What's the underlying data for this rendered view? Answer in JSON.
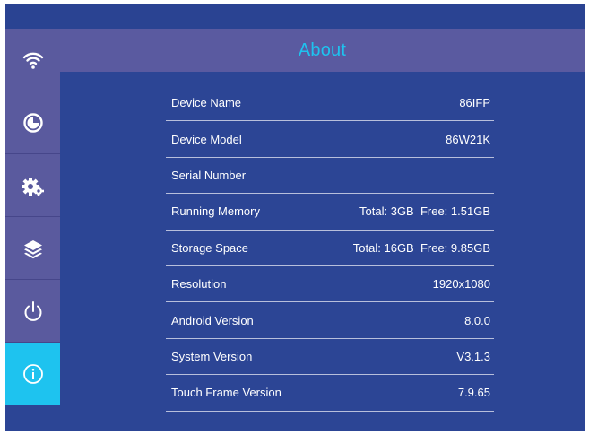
{
  "header": {
    "title": "About"
  },
  "sidebar": {
    "items": [
      {
        "icon": "wifi-icon",
        "active": false
      },
      {
        "icon": "pie-chart-icon",
        "active": false
      },
      {
        "icon": "gears-icon",
        "active": false
      },
      {
        "icon": "layers-icon",
        "active": false
      },
      {
        "icon": "power-icon",
        "active": false
      },
      {
        "icon": "info-icon",
        "active": true
      }
    ]
  },
  "info": {
    "rows": [
      {
        "label": "Device Name",
        "value": "86IFP"
      },
      {
        "label": "Device Model",
        "value": "86W21K"
      },
      {
        "label": "Serial Number",
        "value": ""
      },
      {
        "label": "Running Memory",
        "value": "Total: 3GB  Free: 1.51GB"
      },
      {
        "label": "Storage Space",
        "value": "Total: 16GB  Free: 9.85GB"
      },
      {
        "label": "Resolution",
        "value": "1920x1080"
      },
      {
        "label": "Android Version",
        "value": "8.0.0"
      },
      {
        "label": "System Version",
        "value": "V3.1.3"
      },
      {
        "label": "Touch Frame Version",
        "value": "7.9.65"
      }
    ]
  },
  "colors": {
    "background": "#2c4595",
    "sidebar": "#5a5a9e",
    "header": "#5a5aa0",
    "accent": "#1ec3ef",
    "text": "#ffffff",
    "divider": "#b8bfdc"
  }
}
